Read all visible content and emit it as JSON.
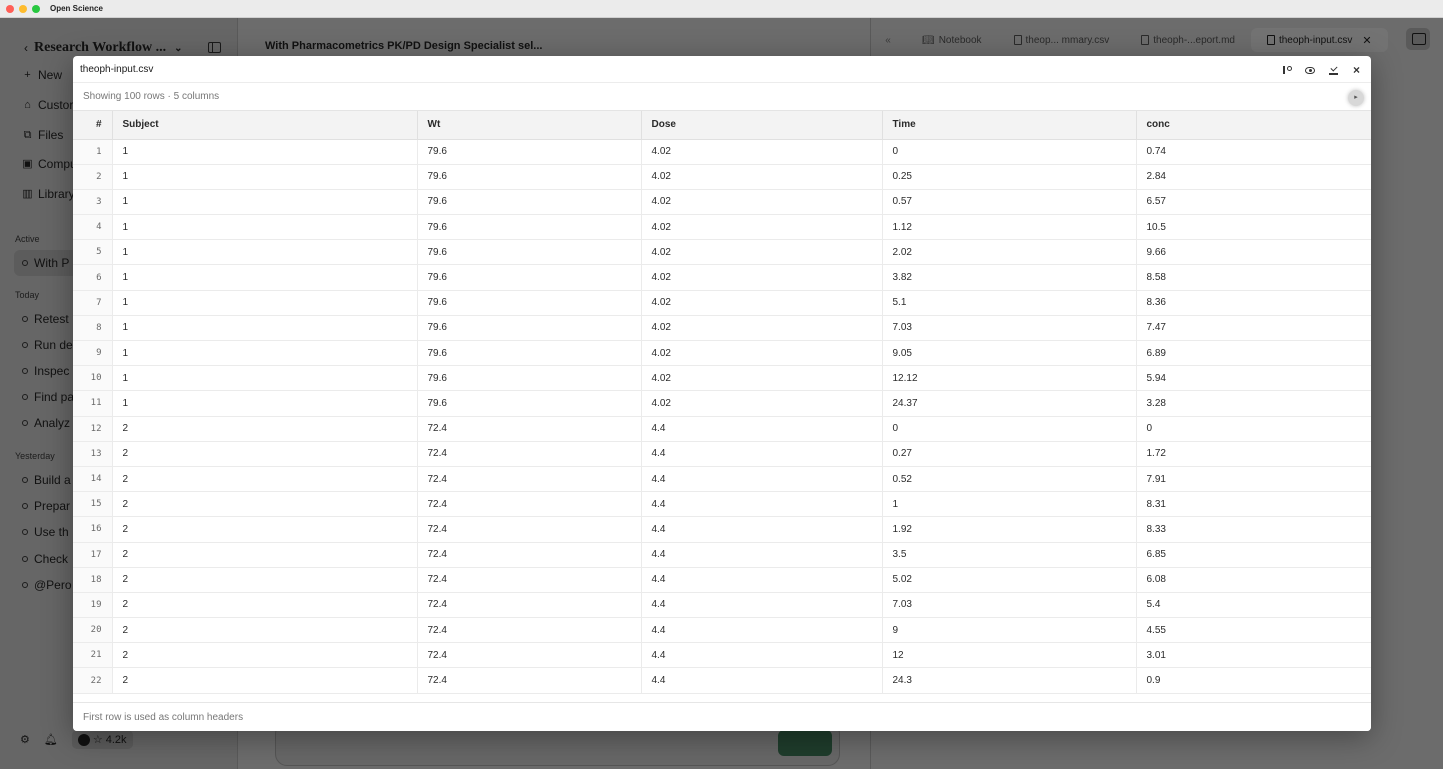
{
  "window": {
    "title": "Open Science",
    "traffic_colors": [
      "#ff5f57",
      "#febc2e",
      "#28c840"
    ]
  },
  "sidebar": {
    "workspace_title": "Research Workflow ...",
    "nav": [
      {
        "icon": "plus-icon",
        "label": "New"
      },
      {
        "icon": "custom-icon",
        "label": "Custor"
      },
      {
        "icon": "files-icon",
        "label": "Files"
      },
      {
        "icon": "compute-icon",
        "label": "Compu"
      },
      {
        "icon": "library-icon",
        "label": "Library"
      }
    ],
    "sections": {
      "active": "Active",
      "today": "Today",
      "yesterday": "Yesterday"
    },
    "active_chats": [
      "With P"
    ],
    "today_chats": [
      "Retest",
      "Run de",
      "Inspec",
      "Find pa",
      "Analyz"
    ],
    "yesterday_chats": [
      "Build a",
      "Prepar",
      "Use th",
      "Check",
      "@Pero"
    ],
    "github_stars": "☆ 4.2k"
  },
  "chat": {
    "title": "With Pharmacometrics PK/PD Design Specialist sel..."
  },
  "tabs": [
    {
      "label": "Notebook",
      "icon": "book-icon",
      "active": false
    },
    {
      "label": "theop... mmary.csv",
      "icon": "doc-icon",
      "active": false
    },
    {
      "label": "theoph-...eport.md",
      "icon": "doc-icon",
      "active": false
    },
    {
      "label": "theoph-input.csv",
      "icon": "doc-icon",
      "active": true
    }
  ],
  "modal": {
    "title": "theoph-input.csv",
    "meta": "Showing 100 rows · 5 columns",
    "footer": "First row is used as column headers",
    "actions": [
      "branch-icon",
      "eye-icon",
      "download-icon",
      "close-icon"
    ],
    "columns": [
      "#",
      "Subject",
      "Wt",
      "Dose",
      "Time",
      "conc"
    ],
    "rows": [
      [
        "1",
        "1",
        "79.6",
        "4.02",
        "0",
        "0.74"
      ],
      [
        "2",
        "1",
        "79.6",
        "4.02",
        "0.25",
        "2.84"
      ],
      [
        "3",
        "1",
        "79.6",
        "4.02",
        "0.57",
        "6.57"
      ],
      [
        "4",
        "1",
        "79.6",
        "4.02",
        "1.12",
        "10.5"
      ],
      [
        "5",
        "1",
        "79.6",
        "4.02",
        "2.02",
        "9.66"
      ],
      [
        "6",
        "1",
        "79.6",
        "4.02",
        "3.82",
        "8.58"
      ],
      [
        "7",
        "1",
        "79.6",
        "4.02",
        "5.1",
        "8.36"
      ],
      [
        "8",
        "1",
        "79.6",
        "4.02",
        "7.03",
        "7.47"
      ],
      [
        "9",
        "1",
        "79.6",
        "4.02",
        "9.05",
        "6.89"
      ],
      [
        "10",
        "1",
        "79.6",
        "4.02",
        "12.12",
        "5.94"
      ],
      [
        "11",
        "1",
        "79.6",
        "4.02",
        "24.37",
        "3.28"
      ],
      [
        "12",
        "2",
        "72.4",
        "4.4",
        "0",
        "0"
      ],
      [
        "13",
        "2",
        "72.4",
        "4.4",
        "0.27",
        "1.72"
      ],
      [
        "14",
        "2",
        "72.4",
        "4.4",
        "0.52",
        "7.91"
      ],
      [
        "15",
        "2",
        "72.4",
        "4.4",
        "1",
        "8.31"
      ],
      [
        "16",
        "2",
        "72.4",
        "4.4",
        "1.92",
        "8.33"
      ],
      [
        "17",
        "2",
        "72.4",
        "4.4",
        "3.5",
        "6.85"
      ],
      [
        "18",
        "2",
        "72.4",
        "4.4",
        "5.02",
        "6.08"
      ],
      [
        "19",
        "2",
        "72.4",
        "4.4",
        "7.03",
        "5.4"
      ],
      [
        "20",
        "2",
        "72.4",
        "4.4",
        "9",
        "4.55"
      ],
      [
        "21",
        "2",
        "72.4",
        "4.4",
        "12",
        "3.01"
      ],
      [
        "22",
        "2",
        "72.4",
        "4.4",
        "24.3",
        "0.9"
      ]
    ]
  }
}
